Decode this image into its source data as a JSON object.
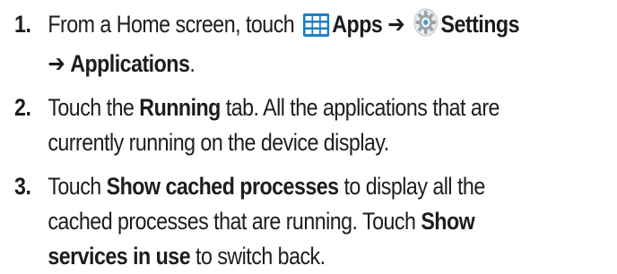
{
  "steps": [
    {
      "number": "1.",
      "lead": "From a Home screen, touch",
      "apps_label": "Apps",
      "arrow1": "➔",
      "settings_label": "Settings",
      "arrow2": "➔",
      "applications_label": "Applications",
      "end": ".",
      "apps_icon": "apps-grid-icon",
      "settings_icon": "settings-gear-icon"
    },
    {
      "number": "2.",
      "lead": "Touch the",
      "running_label": "Running",
      "rest": "tab. All the applications that are currently running on the device display."
    },
    {
      "number": "3.",
      "lead": "Touch",
      "cached_label": "Show cached processes",
      "mid": "to display all the cached processes that are running. Touch",
      "services_label": "Show services in use",
      "rest": "to switch back."
    }
  ],
  "colors": {
    "text": "#1d1d1f",
    "apps_icon_fill": "#1a7fc4",
    "settings_icon_fill": "#9aa3aa"
  }
}
